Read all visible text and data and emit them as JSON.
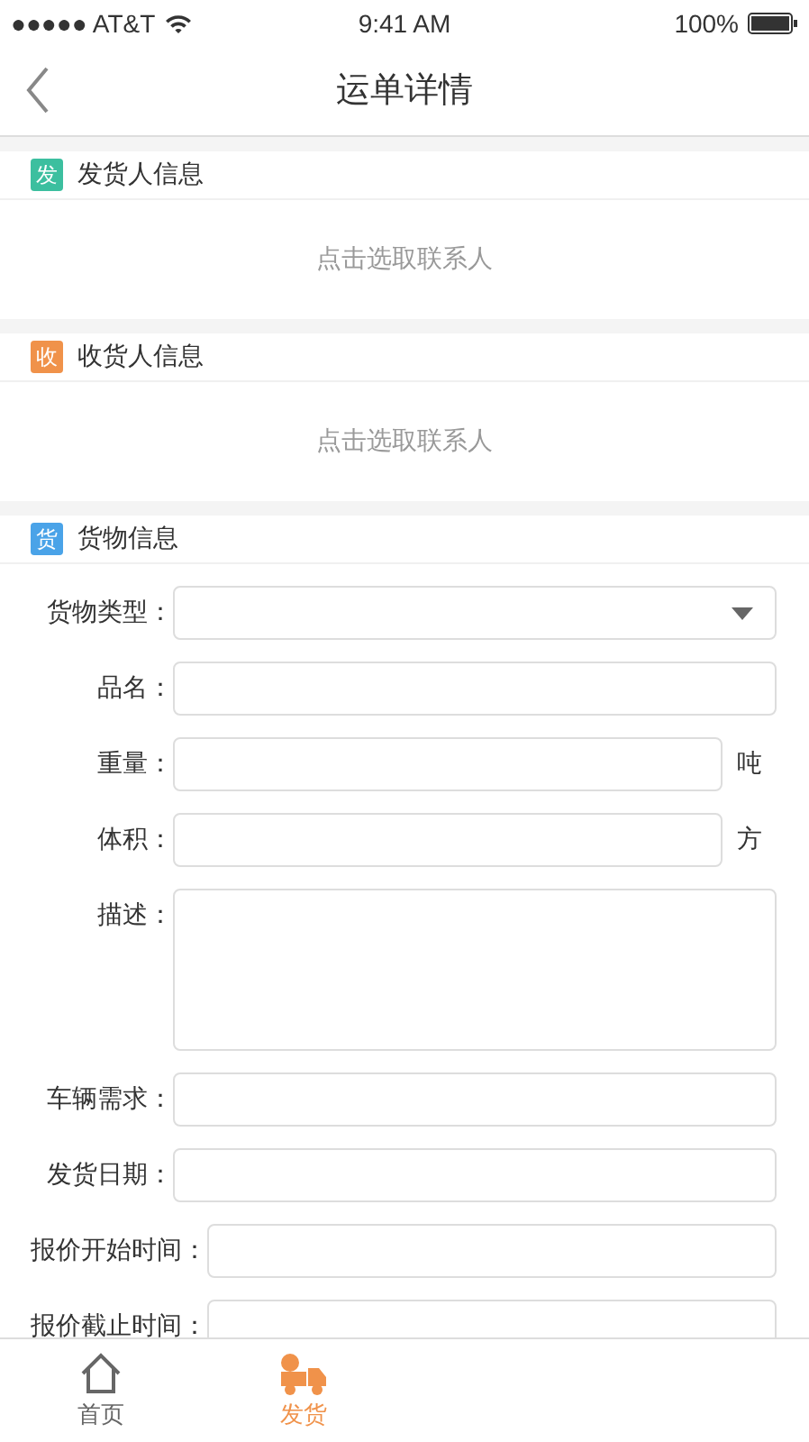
{
  "status_bar": {
    "carrier": "●●●●● AT&T",
    "time": "9:41 AM",
    "battery": "100%"
  },
  "nav": {
    "title": "运单详情"
  },
  "sections": [
    {
      "kind": "contact",
      "badge": "发",
      "color": "#3cbf9f",
      "title": "发货人信息",
      "prompt": "点击选取联系人"
    },
    {
      "kind": "contact",
      "badge": "收",
      "color": "#f0924a",
      "title": "收货人信息",
      "prompt": "点击选取联系人"
    },
    {
      "kind": "form",
      "badge": "货",
      "color": "#4aa3e8",
      "title": "货物信息",
      "fields": [
        {
          "kind": "select",
          "label": "货物类型："
        },
        {
          "kind": "text",
          "label": "品名："
        },
        {
          "kind": "text",
          "label": "重量：",
          "unit": "吨"
        },
        {
          "kind": "text",
          "label": "体积：",
          "unit": "方"
        },
        {
          "kind": "textarea",
          "label": "描述："
        },
        {
          "kind": "text",
          "label": "车辆需求："
        },
        {
          "kind": "text",
          "label": "发货日期："
        },
        {
          "kind": "text",
          "label": "报价开始时间："
        },
        {
          "kind": "text",
          "label": "报价截止时间："
        }
      ]
    }
  ],
  "tab_bar": [
    {
      "kind": "home",
      "label": "首页",
      "selected": false
    },
    {
      "kind": "ship",
      "label": "发货",
      "selected": true
    }
  ]
}
